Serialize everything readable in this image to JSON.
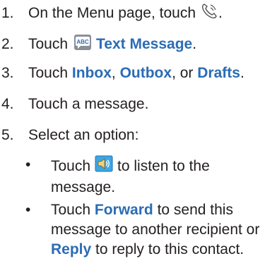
{
  "steps": [
    {
      "num": "1.",
      "text_before": "On the Menu page, touch",
      "icon": "phone-icon",
      "text_after": "."
    },
    {
      "num": "2.",
      "text_before": "Touch",
      "icon": "text-message-app-icon",
      "bold": "Text Message",
      "text_after": "."
    },
    {
      "num": "3.",
      "text_before": "Touch",
      "bold1": "Inbox",
      "sep1": ",",
      "bold2": "Outbox",
      "sep2": ", or",
      "bold3": "Drafts",
      "text_after": "."
    },
    {
      "num": "4.",
      "text": "Touch a message."
    },
    {
      "num": "5.",
      "text": "Select an option:"
    }
  ],
  "bullets": [
    {
      "dot": "•",
      "line1_before": "Touch",
      "icon": "speaker-icon",
      "line1_after": "to listen to the",
      "line2": "message."
    },
    {
      "dot": "•",
      "line1_before": "Touch",
      "bold1": "Forward",
      "line1_after": "to send this",
      "line2": "message to another recipient or",
      "bold2": "Reply",
      "line3_after": "to reply to this contact."
    }
  ],
  "colors": {
    "accent": "#2b6cb5",
    "text": "#231f20"
  }
}
